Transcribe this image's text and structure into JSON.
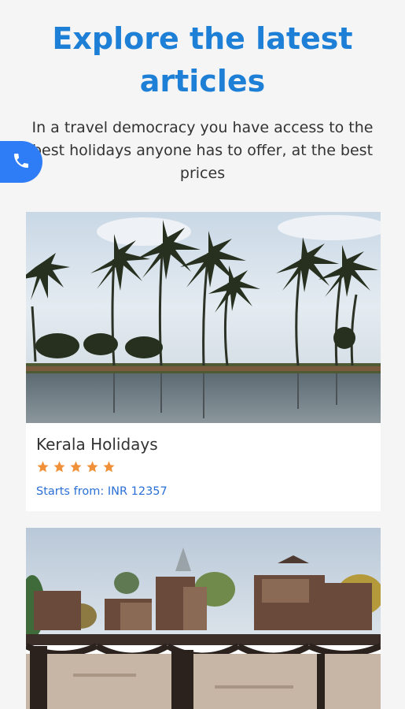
{
  "header": {
    "title_line1": "Explore the latest",
    "title_line2": "articles",
    "subtitle": "In a travel democracy you have access to the best holidays anyone has to offer, at the best prices"
  },
  "call_button": {
    "icon": "phone-icon"
  },
  "articles": [
    {
      "title": "Kerala Holidays",
      "rating": 5,
      "price": "Starts from: INR 12357"
    },
    {
      "title": "",
      "rating": null,
      "price": ""
    }
  ],
  "colors": {
    "accent": "#1e7fd6",
    "call": "#2f7df6",
    "star": "#f0913a",
    "price": "#2b6fd6"
  }
}
